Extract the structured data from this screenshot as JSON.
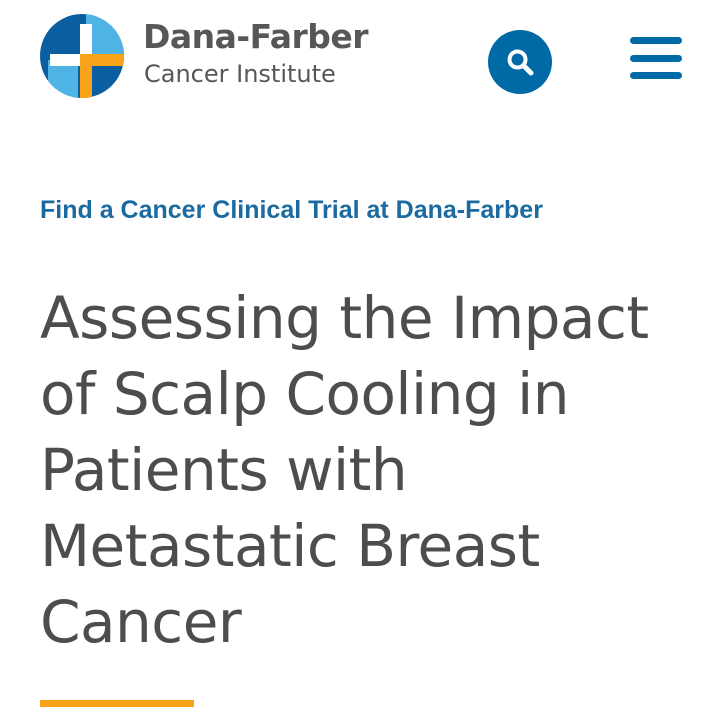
{
  "header": {
    "logo": {
      "name": "Dana-Farber",
      "subtitle": "Cancer Institute",
      "colors": {
        "dark_blue": "#0b5e9f",
        "light_blue": "#6cc3ea",
        "orange": "#f9a31b",
        "gray": "#555759"
      }
    },
    "search_icon": "search-icon",
    "menu_icon": "hamburger-menu-icon",
    "accent_color": "#006aa7"
  },
  "main": {
    "eyebrow_link": "Find a Cancer Clinical Trial at Dana-Farber",
    "title": "Assessing the Impact of Scalp Cooling in Patients with Metastatic Breast Cancer",
    "accent_color": "#f9a31b"
  }
}
